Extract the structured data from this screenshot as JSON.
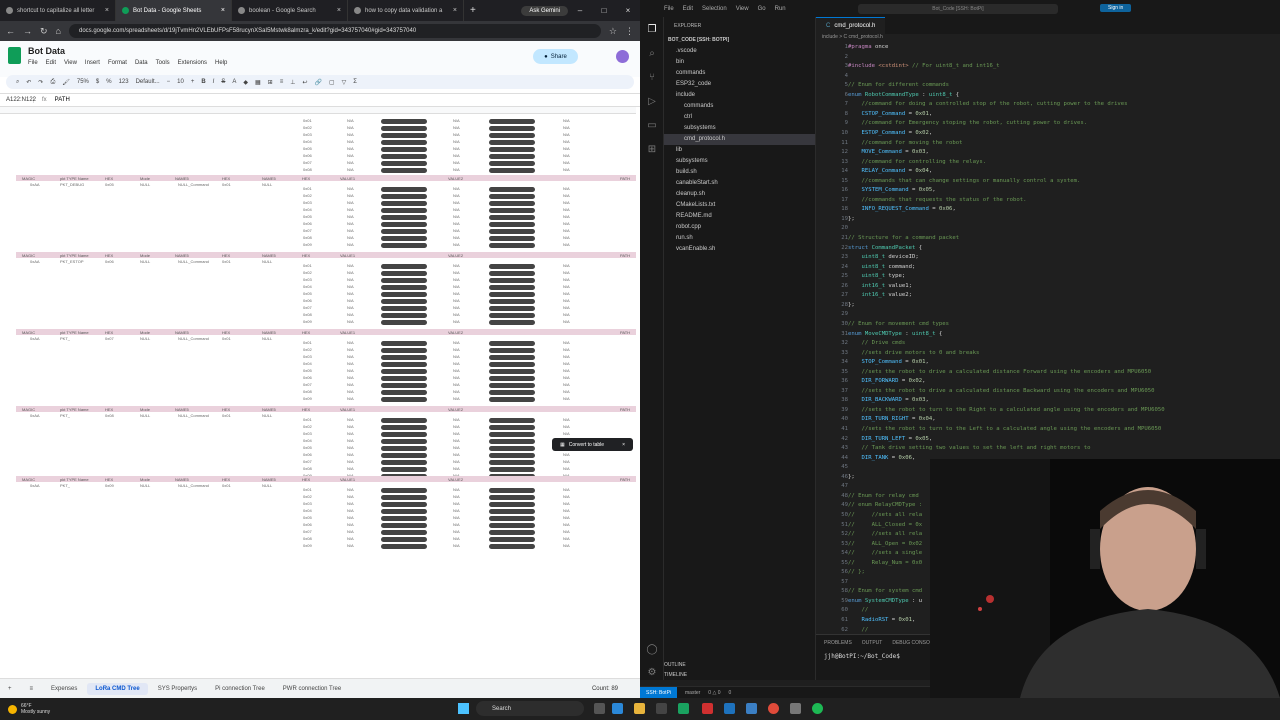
{
  "browser": {
    "tabs": [
      {
        "title": "shortcut to capitalize all letter",
        "active": false
      },
      {
        "title": "Bot Data - Google Sheets",
        "active": true
      },
      {
        "title": "boolean - Google Search",
        "active": false
      },
      {
        "title": "how to copy data validation a",
        "active": false
      }
    ],
    "new_tab": "+",
    "gemini_label": "Ask Gemini",
    "url": "docs.google.com/spreadsheets/d/19jTvmHn2VLEbUFPsF58rucynXSaI5Mstwk8almzra_k/edit?gid=343757040#gid=343757040"
  },
  "sheets": {
    "title": "Bot Data",
    "menus": [
      "File",
      "Edit",
      "View",
      "Insert",
      "Format",
      "Data",
      "Tools",
      "Extensions",
      "Help"
    ],
    "share_label": "Share",
    "toolbar": {
      "zoom": "75%",
      "font": "Default...",
      "font_size": "10",
      "number_format": "123"
    },
    "name_box": "A122:N122",
    "formula_value": "PATH",
    "block_header": [
      "MAGIC",
      "pkt TYPE Name",
      "HEX",
      "Mode",
      "NAME5",
      "HEX",
      "NAME5",
      "HEX",
      "VALUE1",
      "VALUE2",
      "PATH"
    ],
    "block_rows": [
      [
        "0xAA",
        "PKT_DEBUG",
        "0x05",
        "NULL",
        "NULL_Command",
        "0x01",
        "NULL"
      ],
      [
        "0xAA",
        "PKT_ESTOP",
        "0x06",
        "NULL",
        "NULL_Command",
        "0x01",
        "NULL"
      ],
      [
        "0xAA",
        "PKT_",
        "0x07",
        "NULL",
        "NULL_Command",
        "0x01",
        "NULL"
      ],
      [
        "0xAA",
        "PKT_",
        "0x08",
        "NULL",
        "NULL_Command",
        "0x01",
        "NULL"
      ],
      [
        "0xAA",
        "PKT_",
        "0x09",
        "NULL",
        "NULL_Command",
        "0x01",
        "NULL"
      ]
    ],
    "hex_col": [
      "0x01",
      "0x02",
      "0x03",
      "0x04",
      "0x05",
      "0x06",
      "0x07",
      "0x08",
      "0x09"
    ],
    "na": "N/A",
    "convert_label": "Convert to table",
    "sheet_tabs": [
      "Expenses",
      "LoRa CMD Tree",
      "SYS Propertys",
      "Pi connection Tree",
      "PWR connection Tree"
    ],
    "active_sheet": "LoRa CMD Tree",
    "count": "Count: 89"
  },
  "vscode": {
    "menu": [
      "File",
      "Edit",
      "Selection",
      "View",
      "Go",
      "Run"
    ],
    "search": "Bot_Code [SSH: BotPi]",
    "sign_in": "Sign in",
    "explorer_title": "EXPLORER",
    "root": "BOT_CODE [SSH: BOTPI]",
    "tree": [
      ".vscode",
      "bin",
      "commands",
      "ESP32_code",
      "include",
      "commands",
      "ctrl",
      "subsystems",
      "cmd_protocol.h",
      "lib",
      "subsystems",
      "build.sh",
      "canableStart.sh",
      "cleanup.sh",
      "CMakeLists.txt",
      "README.md",
      "robot.cpp",
      "run.sh",
      "vcanEnable.sh"
    ],
    "tab": "cmd_protocol.h",
    "breadcrumb": "include > C cmd_protocol.h",
    "code": [
      "#pragma once",
      "",
      "#include <cstdint> // For uint8_t and int16_t",
      "",
      "// Enum for different commands",
      "enum RobotCommandType : uint8_t {",
      "    //command for doing a controlled stop of the robot, cutting power to the drives",
      "    CSTOP_Command = 0x01,",
      "    //command for Emergency stoping the robot, cutting power to drives.",
      "    ESTOP_Command = 0x02,",
      "    //command for moving the robot",
      "    MOVE_Command = 0x03,",
      "    //command for controlling the relays.",
      "    RELAY_Command = 0x04,",
      "    //commands that can change settings or manually control a system.",
      "    SYSTEM_Command = 0x05,",
      "    //commands that requests the status of the robot.",
      "    INFO_REQUEST_Command = 0x06,",
      "};",
      "",
      "// Structure for a command packet",
      "struct CommandPacket {",
      "    uint8_t deviceID;",
      "    uint8_t command;",
      "    uint8_t type;",
      "    int16_t value1;",
      "    int16_t value2;",
      "};",
      "",
      "// Enum for movement cmd types",
      "enum MoveCMDType : uint8_t {",
      "    // Drive cmds",
      "    //sets drive motors to 0 and breaks",
      "    STOP_Command = 0x01,",
      "    //sets the robot to drive a calculated distance Forward using the encoders and MPU6050",
      "    DIR_FORWARD = 0x02,",
      "    //sets the robot to drive a calculated distance Backward using the encoders and MPU6050",
      "    DIR_BACKWARD = 0x03,",
      "    //sets the robot to turn to the Right to a calculated angle using the encoders and MPU6050",
      "    DIR_TURN_RIGHT = 0x04,",
      "    //sets the robot to turn to the Left to a calculated angle using the encoders and MPU6050",
      "    DIR_TURN_LEFT = 0x05,",
      "    // Tank drive setting two values to set the left and right motors to",
      "    DIR_TANK = 0x06,",
      "",
      "};",
      "",
      "// Enum for relay cmd",
      "// enum RelayCMDType :",
      "//     //sets all rela",
      "//     ALL_Closed = 0x",
      "//     //sets all rela",
      "//     ALL_Open = 0x02",
      "//     //sets a single",
      "//     Relay_Num = 0x0",
      "// };",
      "",
      "// Enum for system cmd",
      "enum SystemCMDType : u",
      "    //",
      "    RadioRST = 0x01,",
      "    //"
    ],
    "panel_tabs": [
      "PROBLEMS",
      "OUTPUT",
      "DEBUG CONSOLE"
    ],
    "terminal": "jjh@BotPI:~/Bot_Code$",
    "outline": "OUTLINE",
    "timeline": "TIMELINE",
    "status": {
      "remote": "SSH: BotPi",
      "branch": "master",
      "problems": "0 △ 0",
      "ports": "0"
    }
  },
  "taskbar": {
    "temp": "66°F",
    "weather": "Mostly sunny",
    "search": "Search"
  },
  "colors": {
    "accent": "#0078d4",
    "sheets_green": "#0f9d58",
    "header_pink": "#ead1dc"
  }
}
